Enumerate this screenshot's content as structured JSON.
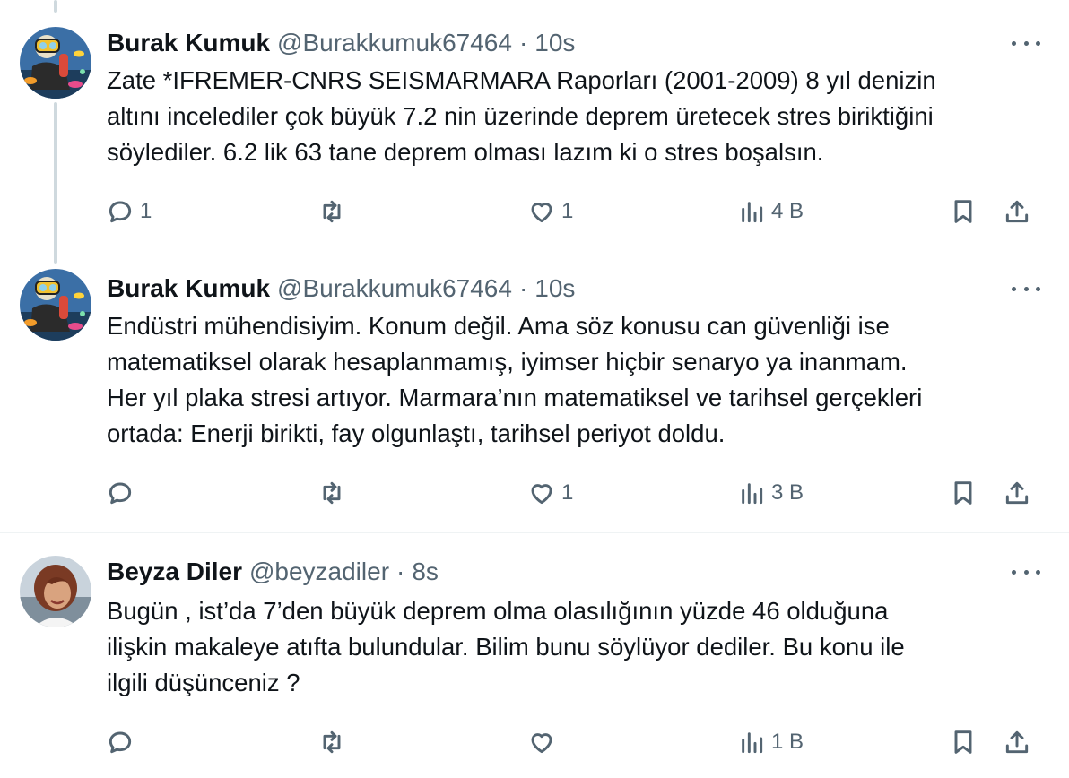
{
  "tweets": [
    {
      "name": "Burak Kumuk",
      "handle": "@Burakkumuk67464",
      "separator": "·",
      "time": "10s",
      "text": "Zate *IFREMER-CNRS SEISMARMARA Raporları (2001-2009) 8 yıl denizin\naltını incelediler çok büyük 7.2 nin üzerinde deprem üretecek stres biriktiğini\nsöylediler. 6.2 lik 63 tane deprem olması lazım ki o stres boşalsın.",
      "replies": "1",
      "retweets": "",
      "likes": "1",
      "views": "4 B"
    },
    {
      "name": "Burak Kumuk",
      "handle": "@Burakkumuk67464",
      "separator": "·",
      "time": "10s",
      "text": "Endüstri mühendisiyim. Konum değil. Ama söz konusu can güvenliği ise\nmatematiksel olarak hesaplanmamış, iyimser hiçbir senaryo ya inanmam.\nHer yıl plaka stresi artıyor. Marmara’nın matematiksel ve tarihsel gerçekleri\nortada: Enerji birikti, fay olgunlaştı, tarihsel periyot doldu.",
      "replies": "",
      "retweets": "",
      "likes": "1",
      "views": "3 B"
    },
    {
      "name": "Beyza Diler",
      "handle": "@beyzadiler",
      "separator": "·",
      "time": "8s",
      "text": "Bugün , ist’da 7’den büyük deprem olma olasılığının yüzde 46 olduğuna\nilişkin makaleye atıfta bulundular. Bilim bunu söylüyor dediler. Bu konu ile\nilgili düşünceniz ?",
      "replies": "",
      "retweets": "",
      "likes": "",
      "views": "1 B"
    }
  ]
}
